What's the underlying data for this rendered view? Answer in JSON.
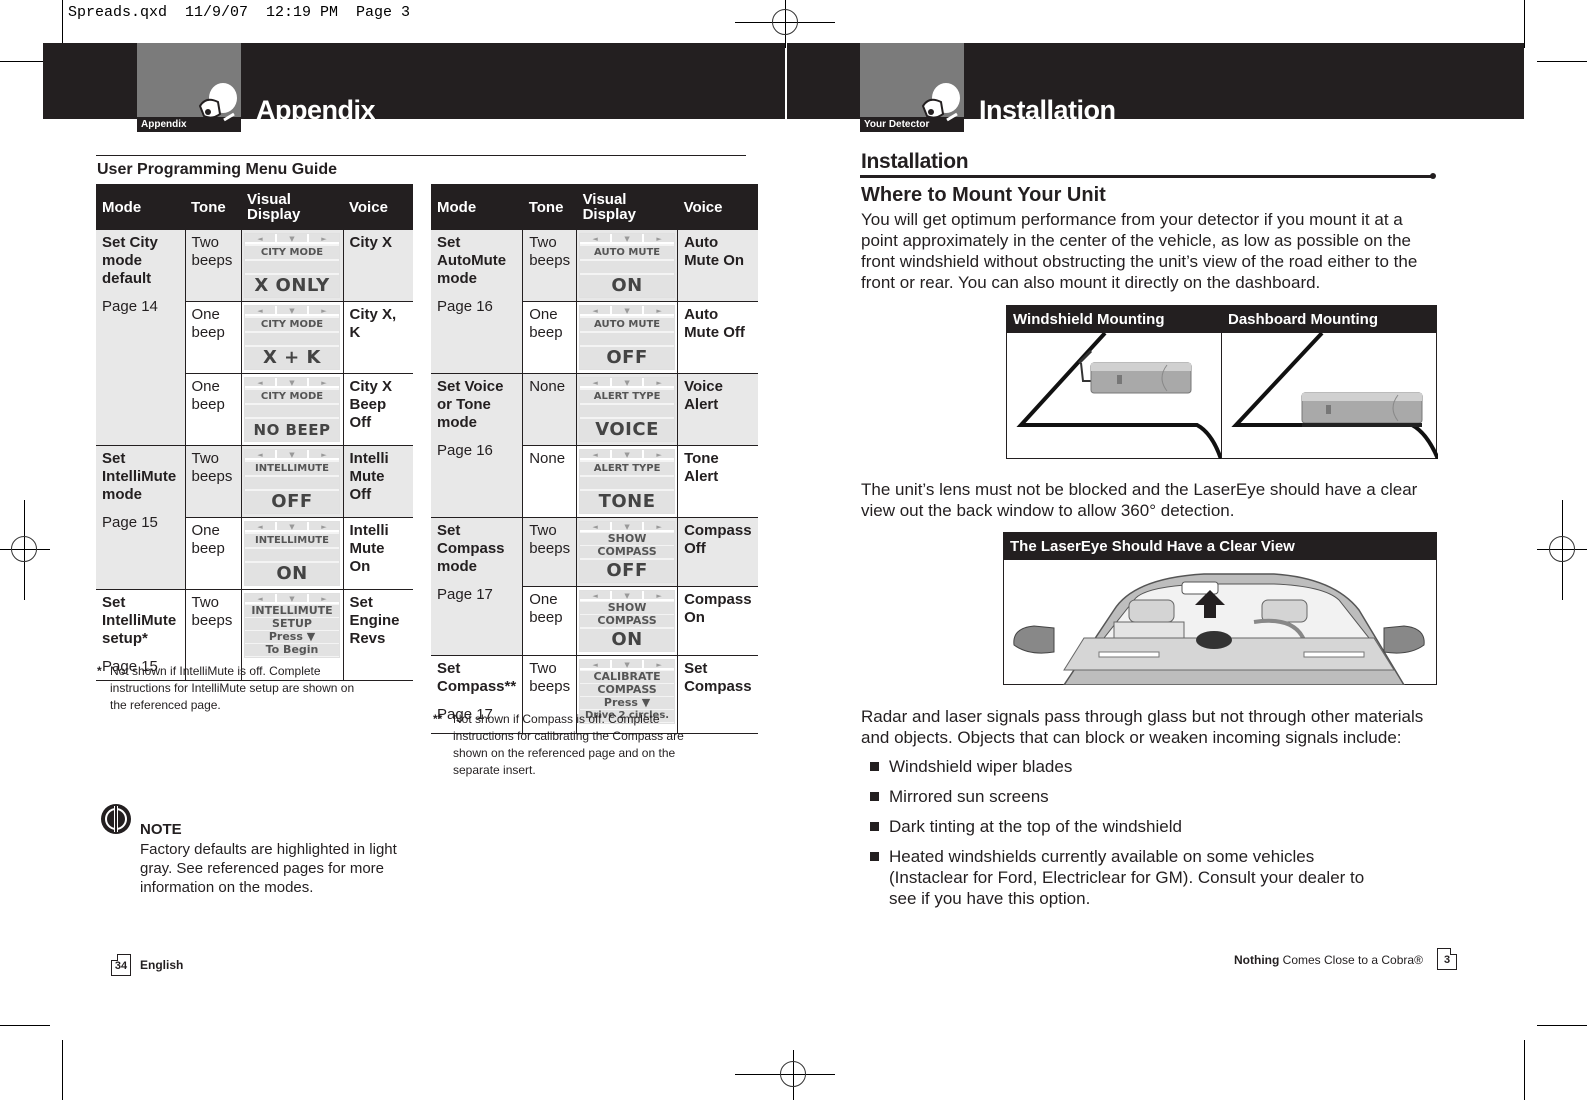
{
  "slug": "Spreads.qxd  11/9/07  12:19 PM  Page 3",
  "left_page": {
    "header": {
      "tab_label": "Appendix",
      "title": "Appendix"
    },
    "guide_title": "User Programming Menu Guide",
    "columns": [
      "Mode",
      "Tone",
      "Visual Display",
      "Voice"
    ],
    "table_left": {
      "groups": [
        {
          "mode": "Set City mode default",
          "page": "Page 14",
          "rows": [
            {
              "tone": "Two beeps",
              "display": [
                "CITY MODE",
                "",
                "X ONLY"
              ],
              "voice": "City X",
              "default": true
            },
            {
              "tone": "One beep",
              "display": [
                "CITY MODE",
                "",
                "X + K"
              ],
              "voice": "City X, K",
              "default": false
            },
            {
              "tone": "One beep",
              "display": [
                "CITY MODE",
                "",
                "NO BEEP"
              ],
              "voice": "City X Beep Off",
              "default": false
            }
          ]
        },
        {
          "mode": "Set IntelliMute mode",
          "page": "Page 15",
          "rows": [
            {
              "tone": "Two beeps",
              "display": [
                "INTELLIMUTE",
                "",
                "OFF"
              ],
              "voice": "Intelli Mute Off",
              "default": true
            },
            {
              "tone": "One beep",
              "display": [
                "INTELLIMUTE",
                "",
                "ON"
              ],
              "voice": "Intelli Mute On",
              "default": false
            }
          ]
        },
        {
          "mode": "Set IntelliMute setup*",
          "page": "Page 15",
          "rows": [
            {
              "tone": "Two beeps",
              "display": [
                "INTELLIMUTE",
                "SETUP",
                "Press ▼",
                "To Begin"
              ],
              "voice": "Set Engine Revs",
              "default": false
            }
          ]
        }
      ],
      "footnote_mark": "*",
      "footnote": "Not shown if IntelliMute is off. Complete instructions for IntelliMute setup are shown on the referenced page."
    },
    "table_right": {
      "groups": [
        {
          "mode": "Set AutoMute mode",
          "page": "Page 16",
          "rows": [
            {
              "tone": "Two beeps",
              "display": [
                "AUTO MUTE",
                "",
                "ON"
              ],
              "voice": "Auto Mute On",
              "default": true
            },
            {
              "tone": "One beep",
              "display": [
                "AUTO MUTE",
                "",
                "OFF"
              ],
              "voice": "Auto Mute Off",
              "default": false
            }
          ]
        },
        {
          "mode": "Set Voice or Tone mode",
          "page": "Page 16",
          "rows": [
            {
              "tone": "None",
              "display": [
                "ALERT TYPE",
                "",
                "VOICE"
              ],
              "voice": "Voice Alert",
              "default": true
            },
            {
              "tone": "None",
              "display": [
                "ALERT TYPE",
                "",
                "TONE"
              ],
              "voice": "Tone Alert",
              "default": false
            }
          ]
        },
        {
          "mode": "Set Compass mode",
          "page": "Page 17",
          "rows": [
            {
              "tone": "Two beeps",
              "display": [
                "SHOW",
                "COMPASS",
                "OFF"
              ],
              "voice": "Compass Off",
              "default": true
            },
            {
              "tone": "One beep",
              "display": [
                "SHOW",
                "COMPASS",
                "ON"
              ],
              "voice": "Compass On",
              "default": false
            }
          ]
        },
        {
          "mode": "Set Compass**",
          "page": "Page 17",
          "rows": [
            {
              "tone": "Two beeps",
              "display": [
                "CALIBRATE",
                "COMPASS",
                "Press ▼",
                "Drive 2 circles."
              ],
              "voice": "Set Compass",
              "default": false
            }
          ]
        }
      ],
      "footnote_mark": "**",
      "footnote": "Not shown if Compass is off. Complete instructions for calibrating the Compass are shown on the referenced page and on the separate insert."
    },
    "note": {
      "icon": "note-icon",
      "title": "NOTE",
      "body": "Factory defaults are highlighted in light gray. See referenced pages for more information on the modes."
    },
    "footer": {
      "page_number": "34",
      "language": "English"
    }
  },
  "right_page": {
    "header": {
      "tab_label": "Your Detector",
      "title": "Installation"
    },
    "section_title": "Installation",
    "subsection_title": "Where to Mount Your Unit",
    "paragraph1": "You will get optimum performance from your detector if you mount it at a point approximately in the center of the vehicle, as low as possible on the front windshield without obstructing the unit’s view of the road either to the front or rear. You can also mount it directly on the dashboard.",
    "figure1": {
      "labels": [
        "Windshield Mounting",
        "Dashboard Mounting"
      ]
    },
    "paragraph2": "The unit’s lens must not be blocked and the LaserEye should have a clear view out the back window to allow 360° detection.",
    "figure2": {
      "label": "The LaserEye Should Have a Clear View"
    },
    "paragraph3": "Radar and laser signals pass through glass but not through other materials and objects. Objects that can block or weaken incoming signals include:",
    "bullets": [
      "Windshield wiper blades",
      "Mirrored sun screens",
      "Dark tinting at the top of the windshield",
      "Heated windshields currently available on some vehicles (Instaclear for Ford, Electriclear for GM). Consult your dealer to see if you have this option."
    ],
    "footer": {
      "tagline_bold": "Nothing",
      "tagline_rest": "Comes Close to a Cobra®",
      "page_number": "3"
    }
  }
}
